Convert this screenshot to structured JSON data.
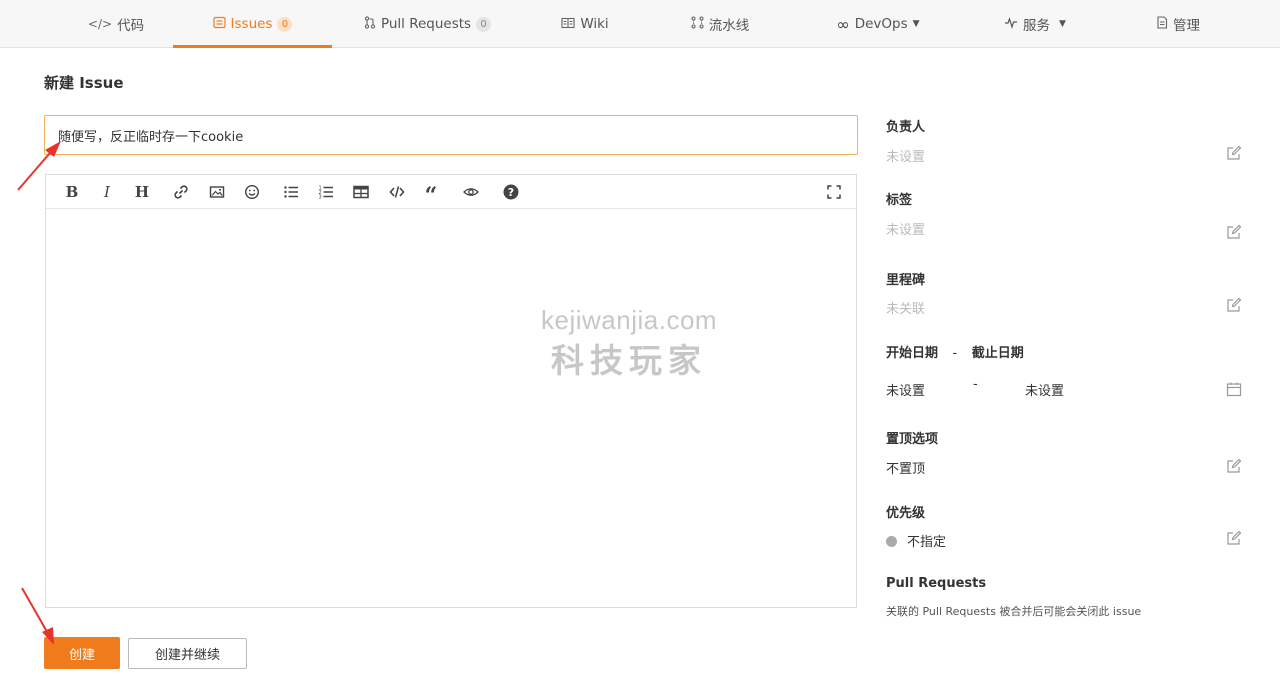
{
  "nav": {
    "tabs": [
      {
        "icon": "code-icon",
        "label": "代码"
      },
      {
        "icon": "issues-icon",
        "label": "Issues",
        "badge": "0"
      },
      {
        "icon": "pull-request-icon",
        "label": "Pull Requests",
        "badge": "0"
      },
      {
        "icon": "wiki-icon",
        "label": "Wiki"
      },
      {
        "icon": "pipeline-icon",
        "label": "流水线"
      },
      {
        "icon": "devops-icon",
        "label": "DevOps"
      },
      {
        "icon": "service-icon",
        "label": "服务"
      },
      {
        "icon": "manage-icon",
        "label": "管理"
      }
    ],
    "active_tab": "Issues"
  },
  "page": {
    "title": "新建 Issue"
  },
  "issue_title": {
    "value": "随便写，反正临时存一下cookie"
  },
  "editor": {
    "toolbar": [
      "bold-icon",
      "italic-icon",
      "heading-icon",
      "link-icon",
      "image-icon",
      "emoji-icon",
      "bullet-list-icon",
      "ordered-list-icon",
      "table-icon",
      "code-icon",
      "quote-icon",
      "preview-icon",
      "help-icon",
      "fullscreen-icon"
    ],
    "content": ""
  },
  "watermark": {
    "line1": "kejiwanjia.com",
    "line2": "科技玩家"
  },
  "actions": {
    "create": "创建",
    "create_continue": "创建并继续"
  },
  "sidebar": {
    "assignee": {
      "label": "负责人",
      "value": "未设置"
    },
    "labels": {
      "label": "标签",
      "value": "未设置"
    },
    "milestone": {
      "label": "里程碑",
      "value": "未关联"
    },
    "dates": {
      "label_start": "开始日期",
      "separator": "-",
      "label_end": "截止日期",
      "start": "未设置",
      "end": "未设置"
    },
    "pin": {
      "label": "置顶选项",
      "value": "不置顶"
    },
    "priority": {
      "label": "优先级",
      "value": "不指定"
    },
    "pull_requests": {
      "label": "Pull Requests",
      "description": "关联的 Pull Requests 被合并后可能会关闭此 issue"
    }
  },
  "colors": {
    "accent": "#f07b1d",
    "annotation_arrow": "#e8332a"
  }
}
